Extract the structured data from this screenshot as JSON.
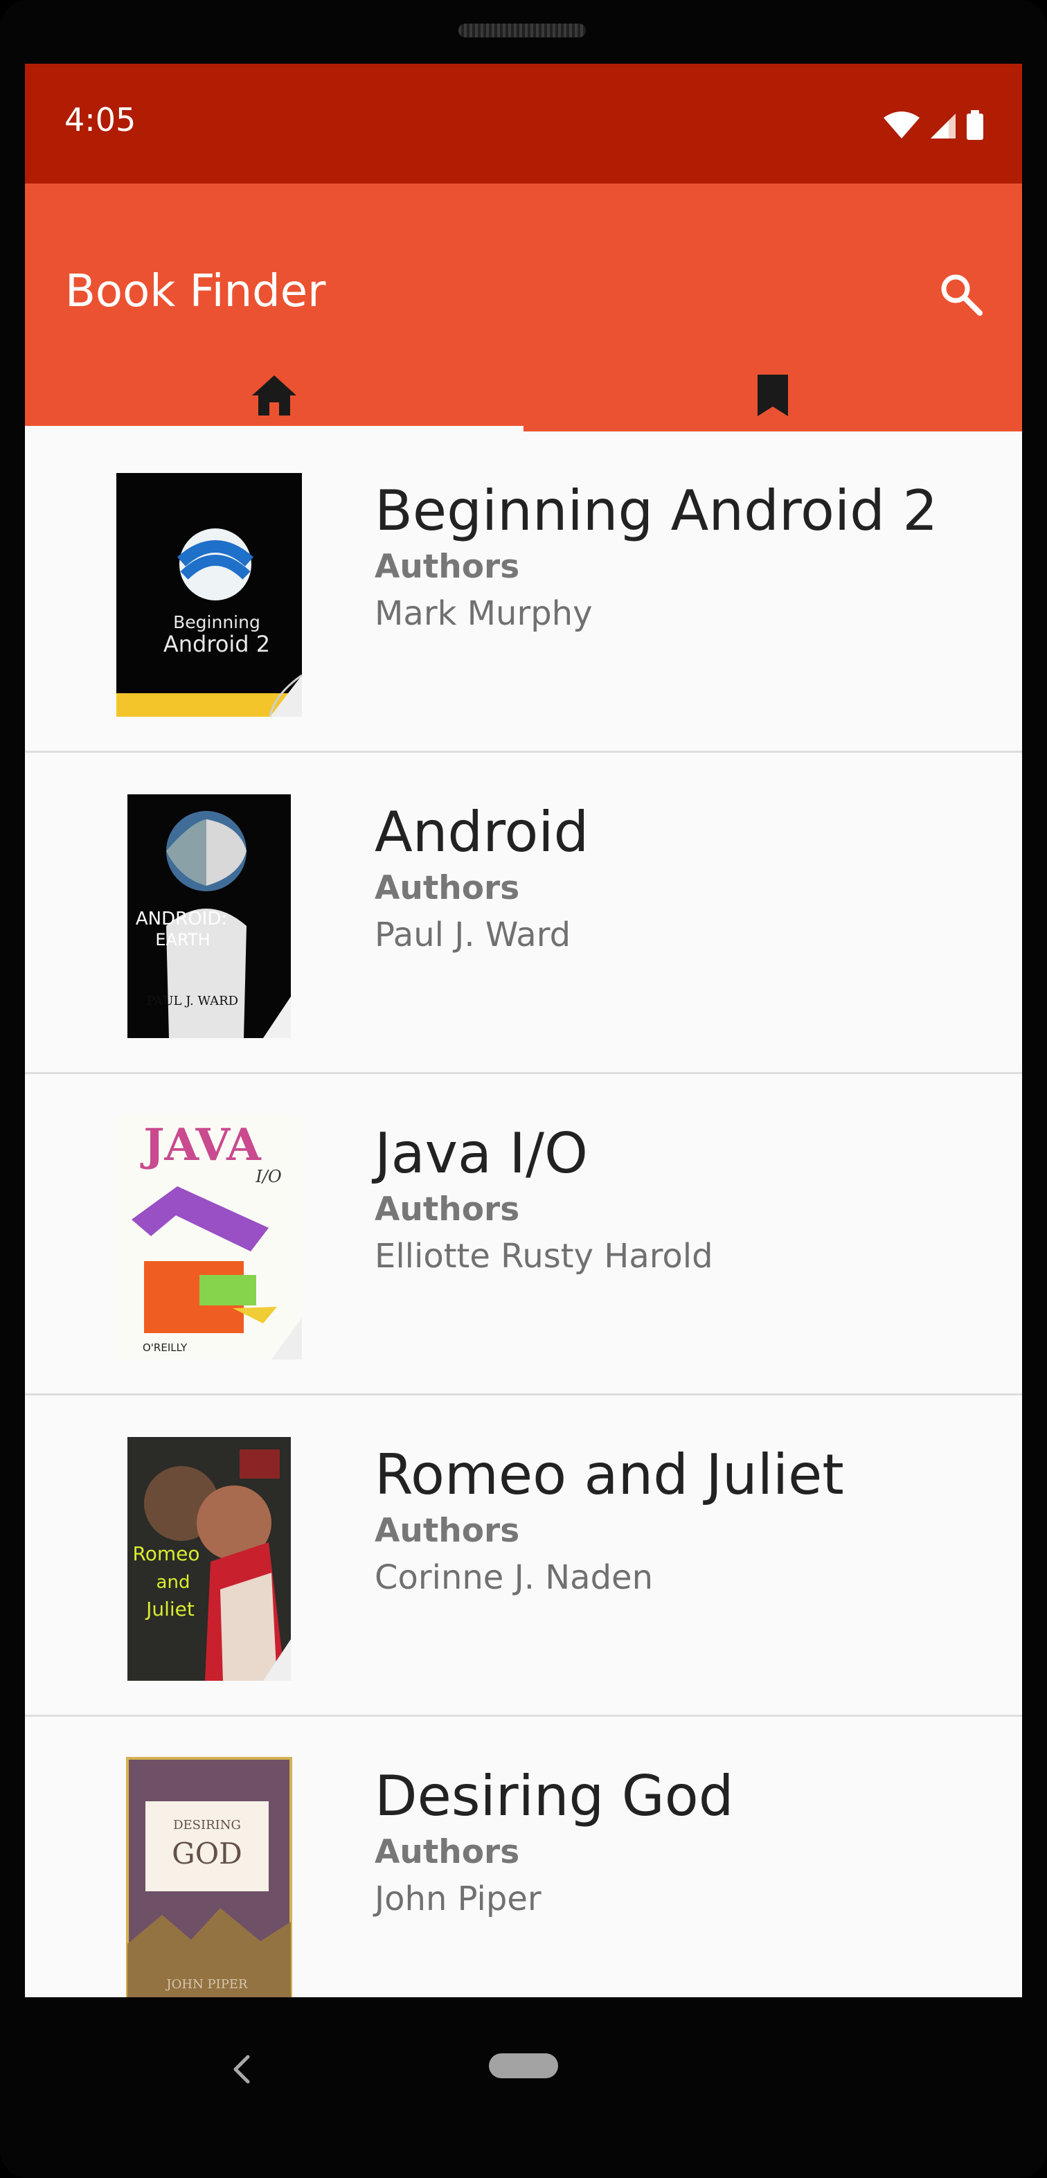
{
  "status_bar": {
    "time": "4:05",
    "icons": [
      "wifi-icon",
      "signal-icon",
      "battery-icon"
    ]
  },
  "app": {
    "title": "Book Finder",
    "colors": {
      "status_bar": "#b01d03",
      "app_bar": "#eb5231",
      "background": "#fafafa",
      "title_text": "#222222",
      "secondary_text": "#777777"
    },
    "icons": {
      "search": "search-icon",
      "home": "home-icon",
      "bookmark": "bookmark-icon",
      "back": "back-icon"
    }
  },
  "tabs": [
    {
      "name": "home",
      "icon": "home-icon",
      "selected": true
    },
    {
      "name": "bookmarks",
      "icon": "bookmark-icon",
      "selected": false
    }
  ],
  "books": [
    {
      "title": "Beginning Android 2",
      "authors_label": "Authors",
      "author": "Mark Murphy",
      "cover_text": [
        "Beginning",
        "Android 2"
      ]
    },
    {
      "title": "Android",
      "authors_label": "Authors",
      "author": "Paul J. Ward",
      "cover_text": [
        "ANDROID:",
        "EARTH",
        "PAUL J. WARD"
      ]
    },
    {
      "title": "Java I/O",
      "authors_label": "Authors",
      "author": "Elliotte Rusty Harold",
      "cover_text": [
        "JAVA",
        "I/O",
        "O'REILLY"
      ]
    },
    {
      "title": "Romeo and Juliet",
      "authors_label": "Authors",
      "author": "Corinne J. Naden",
      "cover_text": [
        "Romeo",
        "and",
        "Juliet"
      ]
    },
    {
      "title": "Desiring God",
      "authors_label": "Authors",
      "author": "John Piper",
      "cover_text": [
        "DESIRING",
        "GOD",
        "JOHN PIPER"
      ]
    }
  ]
}
